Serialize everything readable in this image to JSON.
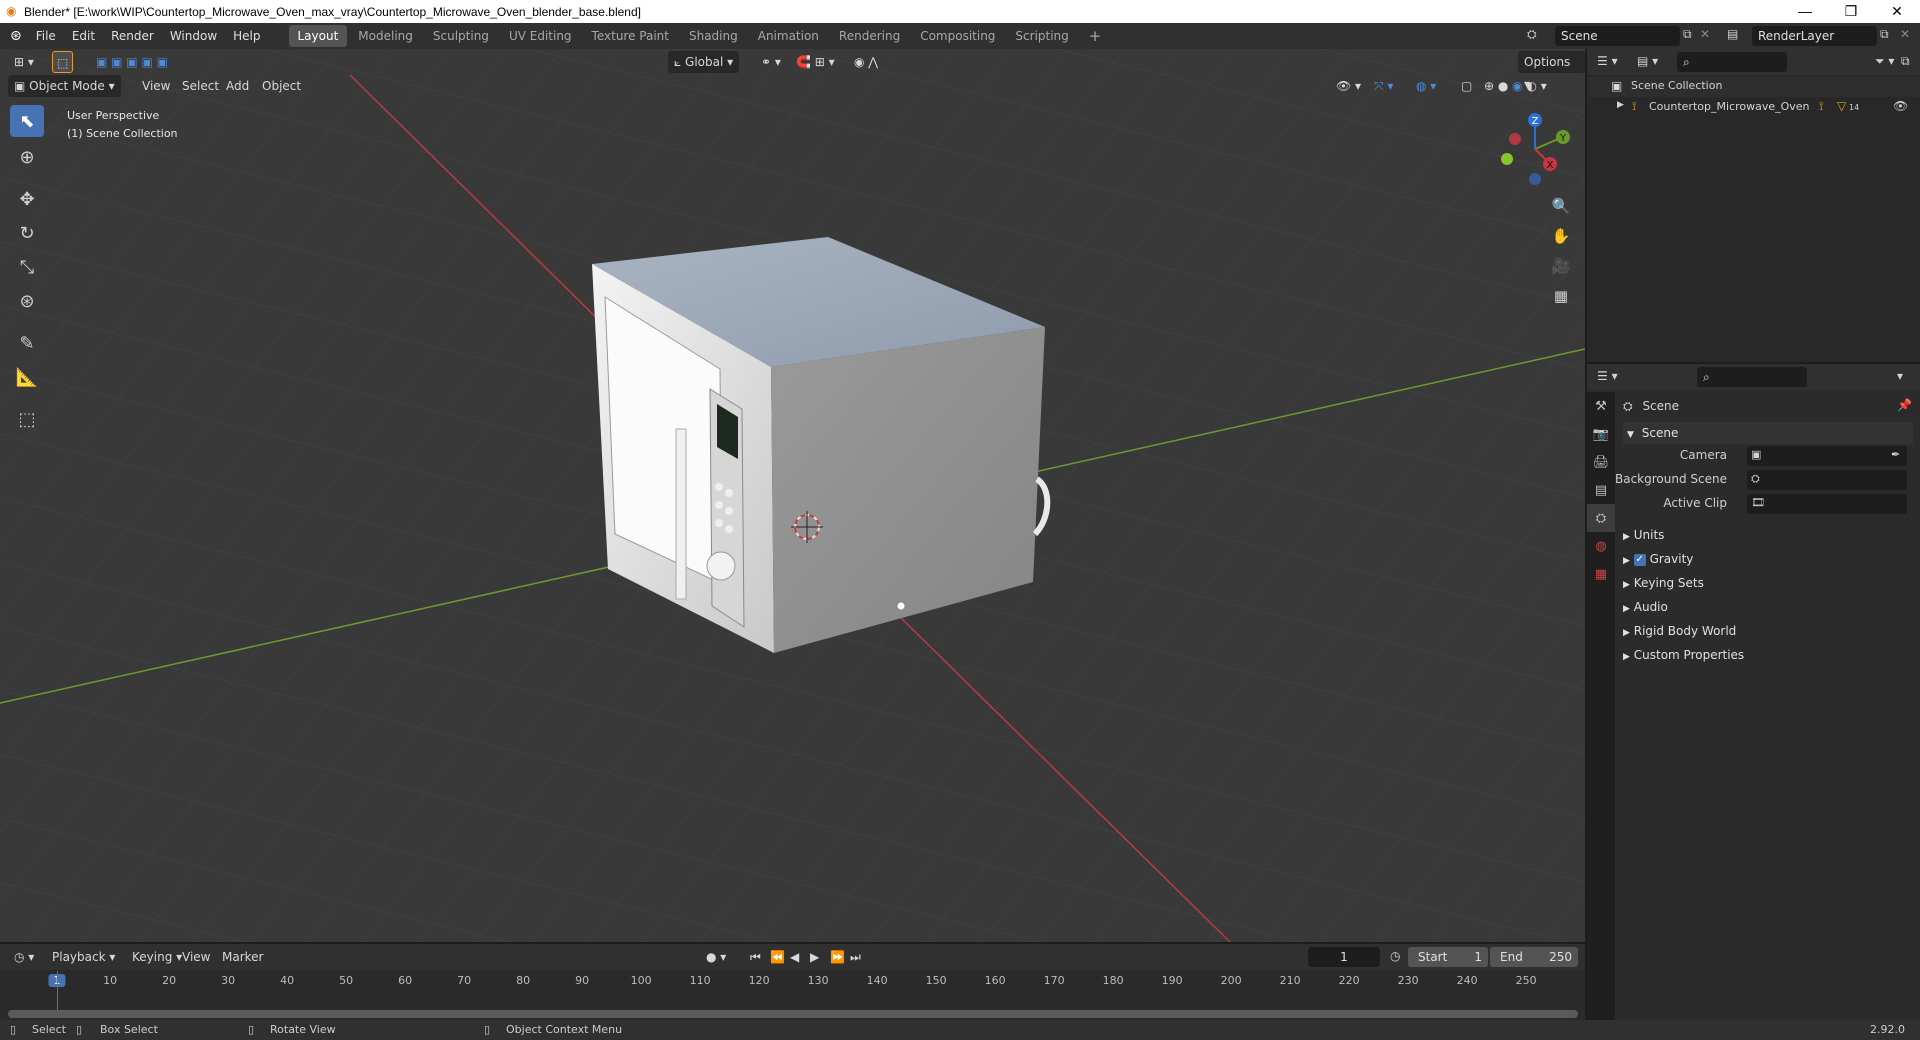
{
  "window": {
    "title": "Blender* [E:\\work\\WIP\\Countertop_Microwave_Oven_max_vray\\Countertop_Microwave_Oven_blender_base.blend]",
    "minimize": "—",
    "maximize": "❐",
    "close": "✕"
  },
  "menu": {
    "items": [
      "File",
      "Edit",
      "Render",
      "Window",
      "Help"
    ]
  },
  "workspaces": {
    "tabs": [
      "Layout",
      "Modeling",
      "Sculpting",
      "UV Editing",
      "Texture Paint",
      "Shading",
      "Animation",
      "Rendering",
      "Compositing",
      "Scripting"
    ],
    "add": "+"
  },
  "scene_selector": {
    "value": "Scene"
  },
  "view_layer_selector": {
    "value": "RenderLayer"
  },
  "viewport": {
    "transform_orientation": "Global",
    "options_label": "Options",
    "mode": "Object Mode",
    "menus": [
      "View",
      "Select",
      "Add",
      "Object"
    ],
    "overlay_text_line1": "User Perspective",
    "overlay_text_line2": "(1) Scene Collection",
    "gizmo": {
      "z": "Z",
      "y": "Y",
      "x": "X"
    }
  },
  "outliner": {
    "root": "Scene Collection",
    "items": [
      {
        "label": "Countertop_Microwave_Oven",
        "badge": "14"
      }
    ]
  },
  "properties": {
    "context": "Scene",
    "section_title": "Scene",
    "fields": {
      "camera_label": "Camera",
      "background_scene_label": "Background Scene",
      "active_clip_label": "Active Clip"
    },
    "panels": [
      "Units",
      "Gravity",
      "Keying Sets",
      "Audio",
      "Rigid Body World",
      "Custom Properties"
    ],
    "gravity_checked": true
  },
  "timeline": {
    "menus": [
      "Playback",
      "Keying",
      "View",
      "Marker"
    ],
    "current_frame": "1",
    "start_label": "Start",
    "start_value": "1",
    "end_label": "End",
    "end_value": "250",
    "ticks": [
      "1",
      "10",
      "20",
      "30",
      "40",
      "50",
      "60",
      "70",
      "80",
      "90",
      "100",
      "110",
      "120",
      "130",
      "140",
      "150",
      "160",
      "170",
      "180",
      "190",
      "200",
      "210",
      "220",
      "230",
      "240",
      "250"
    ]
  },
  "statusbar": {
    "select": "Select",
    "box_select": "Box Select",
    "rotate_view": "Rotate View",
    "context_menu": "Object Context Menu",
    "version": "2.92.0"
  },
  "colors": {
    "accent": "#4772b3",
    "axis_x": "#c8343f",
    "axis_y": "#6a9a2a",
    "axis_z": "#2c6fd6"
  }
}
